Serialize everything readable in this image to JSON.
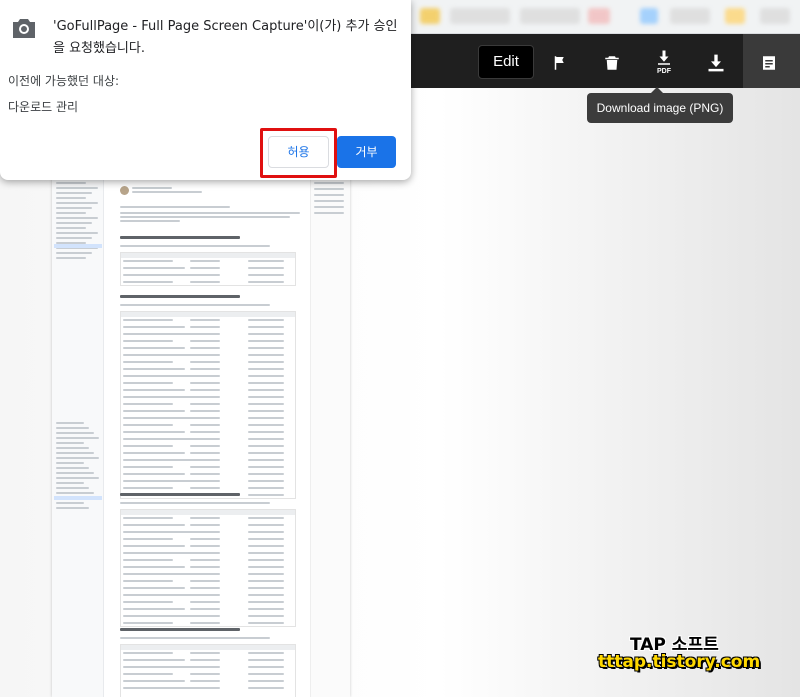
{
  "toolbar": {
    "edit_label": "Edit",
    "pdf_label": "PDF",
    "icons": [
      "flag-icon",
      "trash-icon",
      "download-pdf-icon",
      "download-image-icon",
      "sidebar-notes-icon"
    ]
  },
  "tooltip": {
    "text": "Download image (PNG)"
  },
  "permission_prompt": {
    "title": "'GoFullPage - Full Page Screen Capture'이(가) 추가 승인을 요청했습니다.",
    "subtitle": "이전에 가능했던 대상:",
    "item": "다운로드 관리",
    "allow_label": "허용",
    "deny_label": "거부",
    "icon": "camera-icon"
  },
  "watermark": {
    "line1": "TAP 소프트",
    "line2": "tttap.tistory.com"
  },
  "colors": {
    "toolbar_bg": "#1f1f1f",
    "accent_blue": "#1a73e8",
    "highlight_red": "#e01010",
    "watermark_yellow": "#ffd800"
  }
}
